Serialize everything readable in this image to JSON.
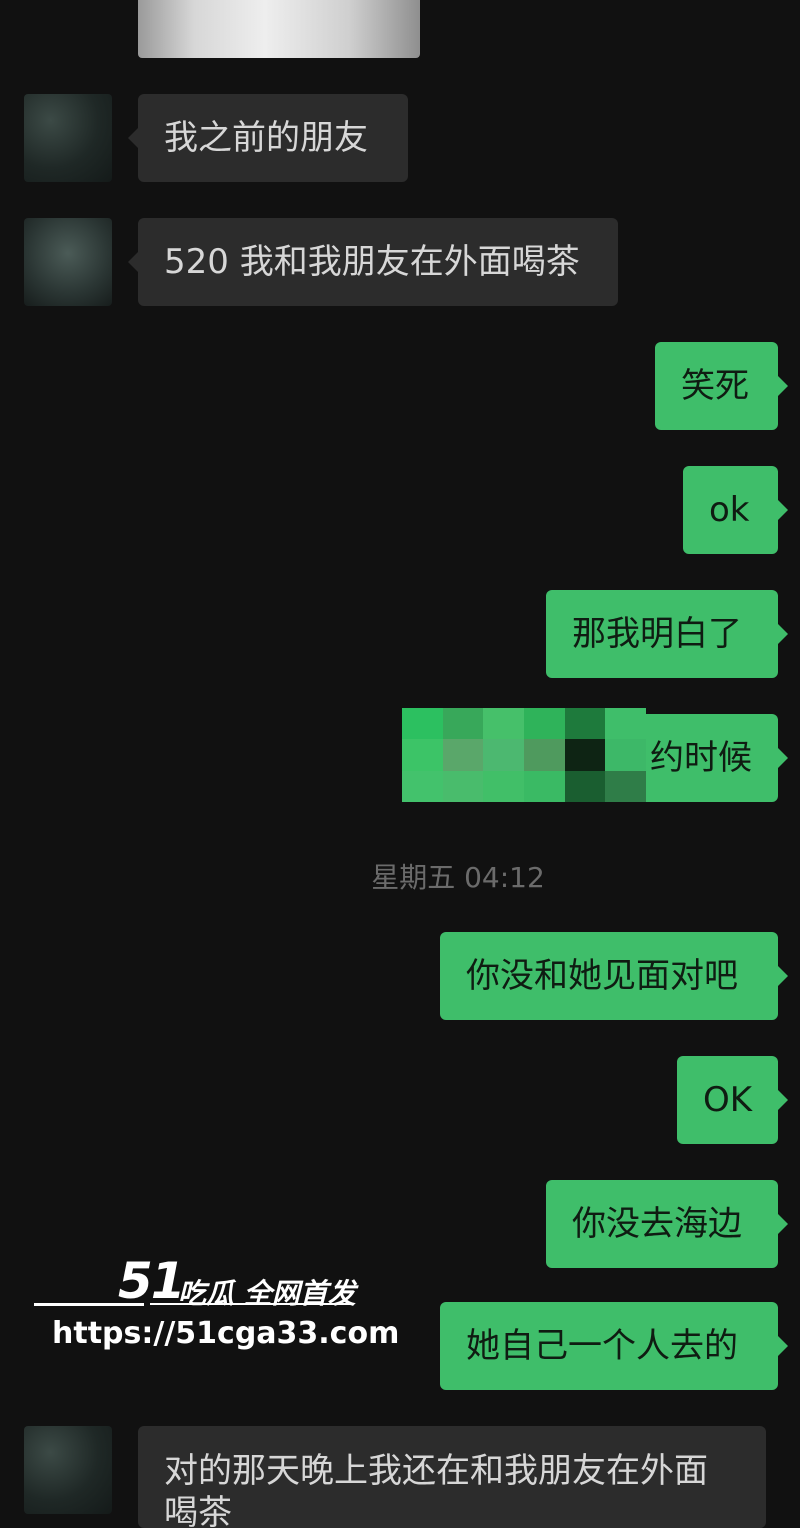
{
  "messages": [
    {
      "side": "left",
      "text": "我之前的朋友"
    },
    {
      "side": "left",
      "text": "520 我和我朋友在外面喝茶"
    },
    {
      "side": "right",
      "text": "笑死"
    },
    {
      "side": "right",
      "text": "ok"
    },
    {
      "side": "right",
      "text": "那我明白了"
    },
    {
      "side": "right",
      "text": "约时候",
      "visible_text": "约时候"
    },
    {
      "side": "right",
      "text": "你没和她见面对吧"
    },
    {
      "side": "right",
      "text": "OK"
    },
    {
      "side": "right",
      "text": "你没去海边"
    },
    {
      "side": "right",
      "text": "她自己一个人去的"
    },
    {
      "side": "left",
      "text": "对的那天晚上我还在和我朋友在外面喝茶"
    }
  ],
  "timestamp": "星期五 04:12",
  "watermark": {
    "brand_number": "51",
    "brand_text": "吃瓜 全网首发",
    "url": "https://51cga33.com"
  },
  "colors": {
    "background": "#111111",
    "outgoing_bubble": "#3fbe6a",
    "incoming_bubble": "#2c2c2c"
  }
}
